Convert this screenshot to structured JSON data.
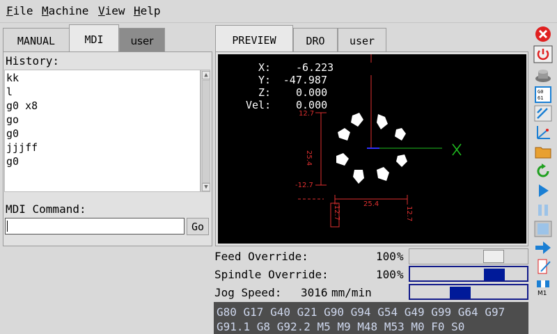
{
  "menu": [
    {
      "label": "File",
      "key": "F",
      "rest": "ile"
    },
    {
      "label": "Machine",
      "key": "M",
      "rest": "achine"
    },
    {
      "label": "View",
      "key": "V",
      "rest": "iew"
    },
    {
      "label": "Help",
      "key": "H",
      "rest": "elp"
    }
  ],
  "left_tabs": [
    "MANUAL",
    "MDI",
    "user"
  ],
  "right_tabs": [
    "PREVIEW",
    "DRO",
    "user"
  ],
  "mdi": {
    "history_label": "History:",
    "history": [
      "kk",
      "l",
      "g0 x8",
      "go",
      "g0",
      "jjjff",
      "g0"
    ],
    "command_label": "MDI Command:",
    "command_value": "",
    "go_label": "Go"
  },
  "dro": {
    "x_label": "X:",
    "x_value": "-6.223",
    "y_label": "Y:",
    "y_value": "-47.987",
    "z_label": "Z:",
    "z_value": "0.000",
    "vel_label": "Vel:",
    "vel_value": "0.000"
  },
  "preview": {
    "dim_top": "12.7",
    "dim_mid": "25.4",
    "dim_bot": "-12.7",
    "dim_h_mid": "25.4",
    "dim_h_left": "-12.7",
    "dim_h_right": "12.7",
    "axis_x_label": "X"
  },
  "overrides": {
    "feed_label": "Feed Override:",
    "feed_value": "100",
    "feed_unit": "%",
    "feed_fraction": 0.77,
    "spindle_label": "Spindle Override:",
    "spindle_value": "100",
    "spindle_unit": "%",
    "spindle_fraction": 0.77,
    "jog_label": "Jog Speed:",
    "jog_value": "3016",
    "jog_unit": "mm/min",
    "jog_fraction": 0.41
  },
  "gcode": {
    "line1": "G80 G17 G40 G21 G90 G94 G54 G49 G99 G64 G97",
    "line2": "G91.1 G8 G92.2 M5 M9 M48 M53 M0 F0 S0"
  },
  "toolbar": [
    "estop-icon",
    "power-icon",
    "home-icon",
    "g54-icon",
    "path-icon",
    "axes-icon",
    "folder-icon",
    "reload-icon",
    "run-icon",
    "pause-icon",
    "step-icon",
    "forward-icon",
    "edit-file-icon",
    "m1-icon"
  ],
  "colors": {
    "estop": "#e02020",
    "accent": "#001a99",
    "toolbar_blue": "#1a7fd4"
  }
}
